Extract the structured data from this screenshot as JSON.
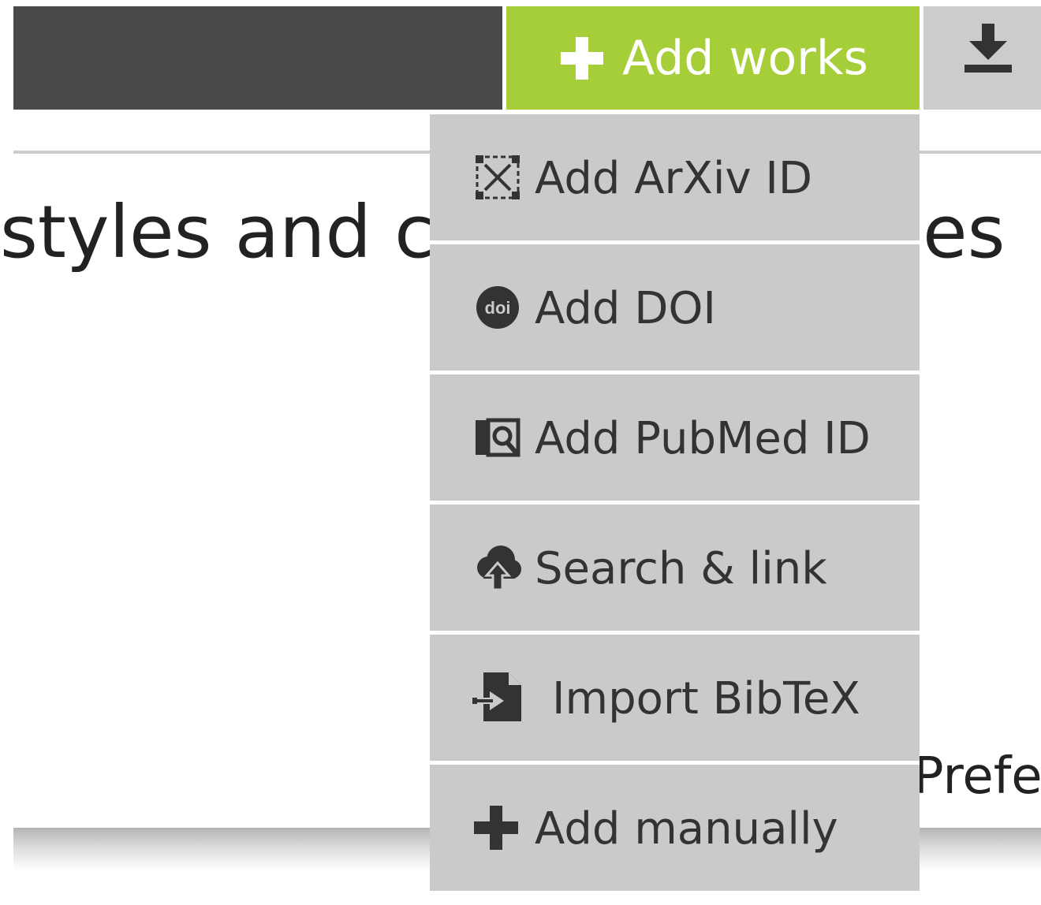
{
  "header": {
    "add_works_label": "Add works"
  },
  "background": {
    "text_left": "styles and ch",
    "text_right": "es",
    "text_partial": "Prefer"
  },
  "dropdown": {
    "items": [
      {
        "label": "Add ArXiv ID",
        "icon": "arxiv-icon"
      },
      {
        "label": "Add DOI",
        "icon": "doi-icon"
      },
      {
        "label": "Add PubMed ID",
        "icon": "pubmed-icon"
      },
      {
        "label": "Search & link",
        "icon": "cloud-upload-icon"
      },
      {
        "label": "Import BibTeX",
        "icon": "file-import-icon"
      },
      {
        "label": "Add manually",
        "icon": "plus-icon"
      }
    ]
  },
  "colors": {
    "dark_bar": "#48494b",
    "accent_green": "#a6ce39",
    "menu_gray": "#c9cacc",
    "icon_dark": "#333333"
  }
}
